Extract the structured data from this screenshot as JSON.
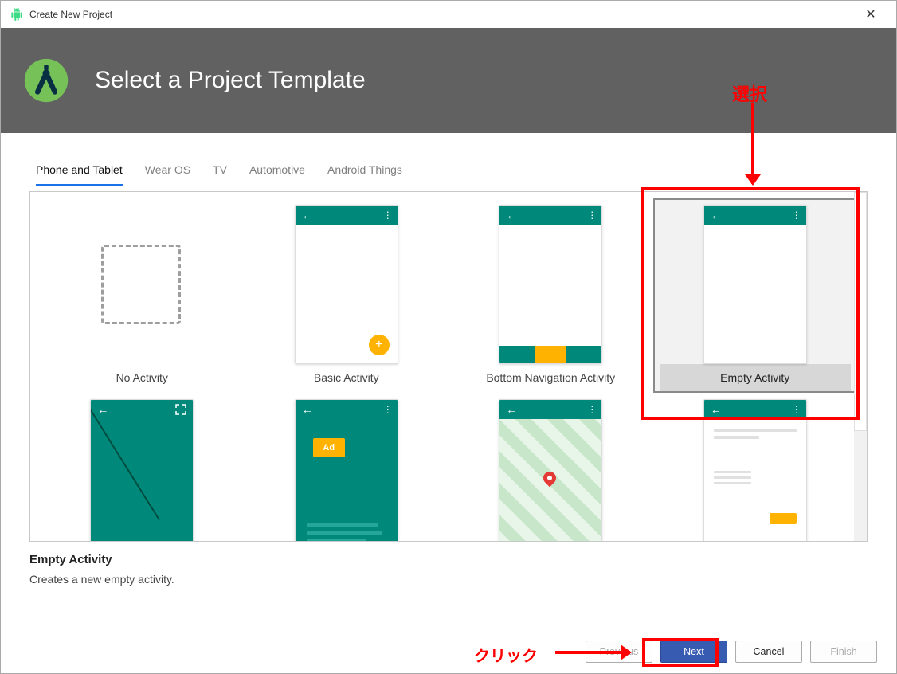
{
  "window": {
    "title": "Create New Project"
  },
  "header": {
    "title": "Select a Project Template"
  },
  "tabs": [
    {
      "label": "Phone and Tablet",
      "active": true
    },
    {
      "label": "Wear OS",
      "active": false
    },
    {
      "label": "TV",
      "active": false
    },
    {
      "label": "Automotive",
      "active": false
    },
    {
      "label": "Android Things",
      "active": false
    }
  ],
  "templates_row1": [
    {
      "label": "No Activity",
      "kind": "none"
    },
    {
      "label": "Basic Activity",
      "kind": "basic"
    },
    {
      "label": "Bottom Navigation Activity",
      "kind": "bottomnav"
    },
    {
      "label": "Empty Activity",
      "kind": "empty",
      "selected": true
    }
  ],
  "templates_row2": [
    {
      "label": "",
      "kind": "fullscreen"
    },
    {
      "label": "",
      "kind": "admob"
    },
    {
      "label": "",
      "kind": "maps"
    },
    {
      "label": "",
      "kind": "masterdetail"
    }
  ],
  "selection": {
    "title": "Empty Activity",
    "description": "Creates a new empty activity."
  },
  "footer": {
    "previous": "Previous",
    "next": "Next",
    "cancel": "Cancel",
    "finish": "Finish"
  },
  "annotations": {
    "select_label": "選択",
    "click_label": "クリック"
  }
}
